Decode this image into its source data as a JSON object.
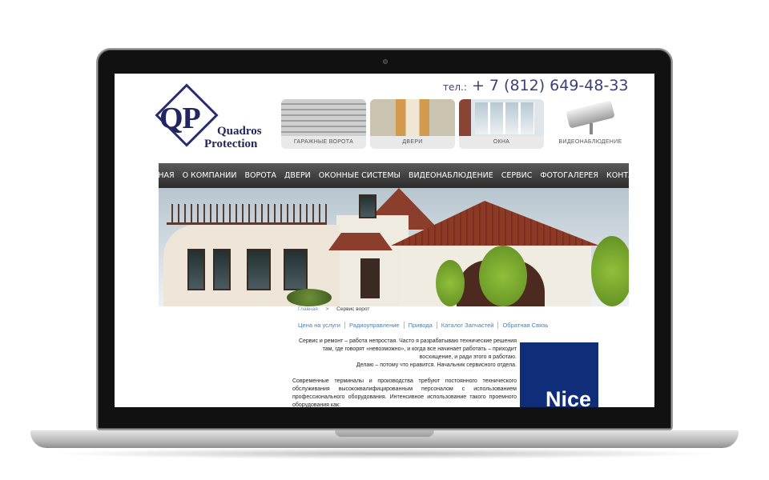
{
  "header": {
    "logo": {
      "initials": "QP",
      "line1": "Quadros",
      "line2": "Protection"
    },
    "phone_prefix": "тел.:",
    "phone_number": "+ 7 (812) 649-48-33"
  },
  "categories": [
    {
      "label": "ГАРАЖНЫЕ ВОРОТА",
      "icon": "garage-door-photo"
    },
    {
      "label": "ДВЕРИ",
      "icon": "doors-photo"
    },
    {
      "label": "ОКНА",
      "icon": "windows-photo"
    },
    {
      "label": "ВИДЕОНАБЛЮДЕНИЕ",
      "icon": "security-camera-icon"
    }
  ],
  "nav": {
    "items": [
      "ГЛАВНАЯ",
      "О КОМПАНИИ",
      "ВОРОТА",
      "ДВЕРИ",
      "ОКОННЫЕ СИСТЕМЫ",
      "ВИДЕОНАБЛЮДЕНИЕ",
      "СЕРВИС",
      "ФОТОГАЛЕРЕЯ",
      "КОНТАКТЫ"
    ]
  },
  "breadcrumb": {
    "home": "Главная",
    "separator": ">",
    "current": "Сервис ворот"
  },
  "subnav": {
    "items": [
      "Цена на услуги",
      "Радиоуправление",
      "Привода",
      "Каталог Запчастей",
      "Обратная Связь"
    ]
  },
  "content": {
    "intro_line1": "Сервис и ремонт – работа непростая. Часто я разрабатываю технические решения",
    "intro_line2": "там, где говорят «невозможно», и когда все начинает работать – приходит",
    "intro_line3": "восхищение, и ради этого я работаю.",
    "intro_line4": "Делаю – потому что нравится. Начальник сервисного отдела.",
    "body": "Современные терминалы и производства требуют постоянного технического обслуживания высококвалифицированным персоналом с использованием профессионального оборудования. Интенсивное использование такого проемного оборудования как:"
  },
  "banner": {
    "brand": "Nice",
    "color": "#0f2d78"
  }
}
